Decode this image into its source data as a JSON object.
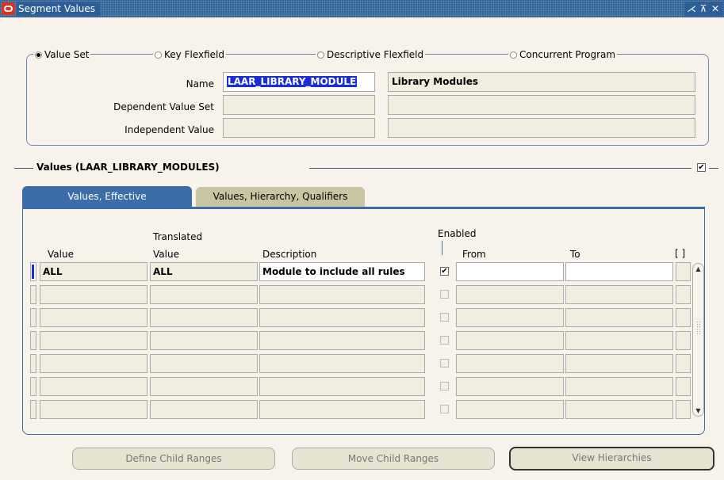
{
  "window": {
    "title": "Segment Values",
    "controls": [
      "⋌",
      "⊼",
      "✕"
    ]
  },
  "radio_group": {
    "options": [
      {
        "label": "Value Set",
        "selected": true
      },
      {
        "label": "Key Flexfield",
        "selected": false
      },
      {
        "label": "Descriptive Flexfield",
        "selected": false
      },
      {
        "label": "Concurrent Program",
        "selected": false
      }
    ]
  },
  "form": {
    "name_label": "Name",
    "name_value": "LAAR_LIBRARY_MODULE",
    "name_description": "Library Modules",
    "dependent_label": "Dependent Value Set",
    "dependent_value": "",
    "dependent_description": "",
    "independent_label": "Independent Value",
    "independent_value": "",
    "independent_description": ""
  },
  "section": {
    "title": "Values (LAAR_LIBRARY_MODULES)",
    "checked": true
  },
  "tabs": [
    {
      "label": "Values, Effective",
      "active": true
    },
    {
      "label": "Values, Hierarchy, Qualifiers",
      "active": false
    }
  ],
  "table": {
    "headers": {
      "value": "Value",
      "translated_top": "Translated",
      "translated_bottom": "Value",
      "description": "Description",
      "enabled": "Enabled",
      "from": "From",
      "to": "To",
      "dff": "[ ]"
    },
    "rows": [
      {
        "value": "ALL",
        "translated": "ALL",
        "description": "Module to include all rules",
        "enabled": true,
        "from": "",
        "to": ""
      },
      {
        "value": "",
        "translated": "",
        "description": "",
        "enabled": false,
        "from": "",
        "to": ""
      },
      {
        "value": "",
        "translated": "",
        "description": "",
        "enabled": false,
        "from": "",
        "to": ""
      },
      {
        "value": "",
        "translated": "",
        "description": "",
        "enabled": false,
        "from": "",
        "to": ""
      },
      {
        "value": "",
        "translated": "",
        "description": "",
        "enabled": false,
        "from": "",
        "to": ""
      },
      {
        "value": "",
        "translated": "",
        "description": "",
        "enabled": false,
        "from": "",
        "to": ""
      },
      {
        "value": "",
        "translated": "",
        "description": "",
        "enabled": false,
        "from": "",
        "to": ""
      }
    ]
  },
  "buttons": {
    "define_child_ranges": "Define Child Ranges",
    "move_child_ranges": "Move Child Ranges",
    "view_hierarchies": "View Hierarchies"
  },
  "colors": {
    "titlebar": "#2d5f96",
    "tab_active": "#3b6ea8",
    "tab_inactive": "#c9c4a1",
    "field_bg": "#f0eedf",
    "selection": "#1a2dd6"
  }
}
